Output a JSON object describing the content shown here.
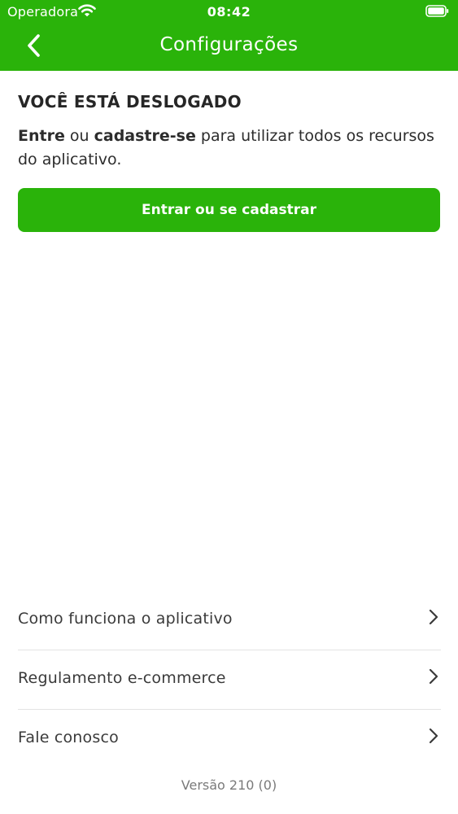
{
  "colors": {
    "brand_green": "#2ab30a",
    "text_dark": "#262626",
    "text_muted": "#7a7a7a",
    "divider": "#e3e3e3"
  },
  "status_bar": {
    "carrier": "Operadora",
    "time": "08:42",
    "wifi_icon": "wifi-icon",
    "battery_icon": "battery-icon"
  },
  "nav": {
    "title": "Configurações",
    "back_icon": "chevron-left-icon"
  },
  "logout": {
    "title": "VOCÊ ESTÁ DESLOGADO",
    "text_bold_1": "Entre",
    "text_mid": " ou ",
    "text_bold_2": "cadastre-se",
    "text_end": " para utilizar todos os recursos do aplicativo.",
    "button_label": "Entrar ou se cadastrar"
  },
  "menu": {
    "items": [
      {
        "label": "Como funciona o aplicativo",
        "icon": "chevron-right-icon"
      },
      {
        "label": "Regulamento e-commerce",
        "icon": "chevron-right-icon"
      },
      {
        "label": "Fale conosco",
        "icon": "chevron-right-icon"
      }
    ]
  },
  "footer": {
    "version": "Versão 210 (0)"
  }
}
